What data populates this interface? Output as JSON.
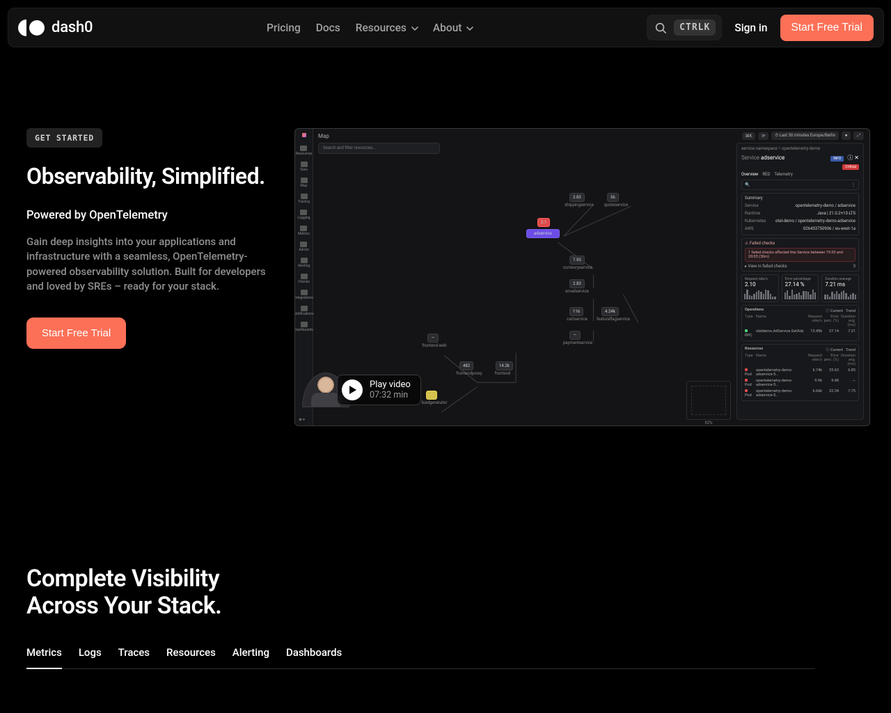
{
  "nav": {
    "brand": "dash0",
    "links": {
      "pricing": "Pricing",
      "docs": "Docs",
      "resources": "Resources",
      "about": "About"
    },
    "search_kbd": "CTRLK",
    "signin": "Sign in",
    "cta": "Start Free Trial"
  },
  "hero": {
    "pill": "GET STARTED",
    "title": "Observability, Simplified.",
    "subtitle": "Powered by OpenTelemetry",
    "body": "Gain deep insights into your applications and infrastructure with a seamless, OpenTelemetry-powered observability solution. Built for developers and loved by SREs – ready for your stack.",
    "cta": "Start Free Trial"
  },
  "video": {
    "play": "Play video",
    "duration": "07:32 min"
  },
  "shot": {
    "map_label": "Map",
    "search_placeholder": "Search and filter resources…",
    "time_range": "Last 30 minutes",
    "tz": "Europe/Berlin",
    "rail": [
      "Resources",
      "View",
      "Map",
      "Tracing",
      "Logging",
      "Metrics",
      "Admin",
      "Alerting",
      "Checks",
      "Integrations",
      "Notifications",
      "Dashboards"
    ],
    "nodes": {
      "shippingservice": "shippingservice",
      "quoteservice": "quoteservice",
      "adservice": "adservice",
      "currencyservice": "currencyservice",
      "emailservice": "emailservice",
      "cartservice": "cartservice",
      "paymentservice": "paymentservice",
      "featureflagservice": "featureflagservice",
      "frontend_web": "frontend-web",
      "frontend_proxy": "frontendproxy",
      "frontend": "frontend",
      "loadgenerator": "loadgenerator"
    },
    "panel": {
      "crumb": "service.namespace = opentelemetry-demo",
      "service_label": "Service",
      "service": "adservice",
      "info": "INFO",
      "status": "Critical",
      "tabs": [
        "Overview",
        "RED",
        "Telemetry"
      ],
      "summary_label": "Summary",
      "rows": [
        {
          "k": "Service",
          "v": "opentelemetry-demo / adservice"
        },
        {
          "k": "Runtime",
          "v": "Java  |  21.0.2+13-LTS"
        },
        {
          "k": "Kubernetes",
          "v": "otel-demo / opentelemetry-demo-adservice"
        },
        {
          "k": "AWS",
          "v": "026433750906 / eu-west-1a"
        }
      ],
      "failed_title": "Failed checks",
      "failed_msg": "1 failed checks affected this Service between 19:33 and 20:03 (30m)",
      "failed_link": "View in failed checks",
      "failed_count": "3",
      "metrics": [
        {
          "label": "Request rate/s",
          "value": "2.10"
        },
        {
          "label": "Error percentage",
          "value": "27.14 %"
        },
        {
          "label": "Duration average",
          "value": "7.21 ms"
        }
      ],
      "ops_label": "Operations",
      "res_label": "Resources",
      "cols_current": "Current",
      "cols_trend": "Trend",
      "op_cols": [
        "Type",
        "Name",
        "Request rate/s",
        "Error perc. (%)",
        "Duration avg. (ms)"
      ],
      "ops": [
        {
          "type": "RPC",
          "name": "oteldemo.AdService.GetAds",
          "r": "13.49k",
          "e": "27.14",
          "d": "7.21"
        }
      ],
      "res": [
        {
          "type": "Pod",
          "name": "opentelemetry-demo-adservice-5…",
          "r": "6.74k",
          "e": "33.63",
          "d": "6.85"
        },
        {
          "type": "Pod",
          "name": "opentelemetry-demo-adservice-5…",
          "r": "9.96",
          "e": "9.48",
          "d": "—"
        },
        {
          "type": "Pod",
          "name": "opentelemetry-demo-adservice-5…",
          "r": "6.66k",
          "e": "22.34",
          "d": "7.75"
        }
      ]
    },
    "mini_pct": "92%"
  },
  "section2": {
    "title_l1": "Complete Visibility",
    "title_l2": "Across Your Stack.",
    "tabs": [
      "Metrics",
      "Logs",
      "Traces",
      "Resources",
      "Alerting",
      "Dashboards"
    ]
  }
}
